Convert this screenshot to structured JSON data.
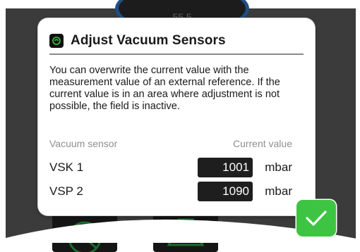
{
  "background": {
    "gauge_value": "55.5"
  },
  "dialog": {
    "title": "Adjust Vacuum Sensors",
    "icon": "app-icon",
    "description": "You can overwrite the current value with the measurement value of an external reference. If the current value is in an area where adjustment is not possible, the field is inactive.",
    "columns": {
      "sensor": "Vacuum sensor",
      "value": "Current value"
    },
    "sensors": [
      {
        "name": "VSK 1",
        "value": "1001",
        "unit": "mbar"
      },
      {
        "name": "VSP 2",
        "value": "1090",
        "unit": "mbar"
      }
    ],
    "confirm_icon": "checkmark-icon"
  },
  "colors": {
    "accent_green": "#3ec443",
    "screen_bg": "#3b3b3b",
    "field_bg": "#1e1e1e"
  }
}
